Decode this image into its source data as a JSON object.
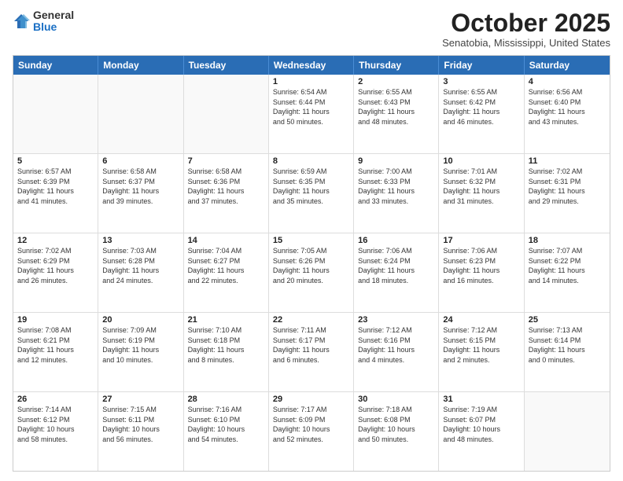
{
  "header": {
    "logo_general": "General",
    "logo_blue": "Blue",
    "month_title": "October 2025",
    "location": "Senatobia, Mississippi, United States"
  },
  "weekdays": [
    "Sunday",
    "Monday",
    "Tuesday",
    "Wednesday",
    "Thursday",
    "Friday",
    "Saturday"
  ],
  "rows": [
    [
      {
        "day": "",
        "info": ""
      },
      {
        "day": "",
        "info": ""
      },
      {
        "day": "",
        "info": ""
      },
      {
        "day": "1",
        "info": "Sunrise: 6:54 AM\nSunset: 6:44 PM\nDaylight: 11 hours\nand 50 minutes."
      },
      {
        "day": "2",
        "info": "Sunrise: 6:55 AM\nSunset: 6:43 PM\nDaylight: 11 hours\nand 48 minutes."
      },
      {
        "day": "3",
        "info": "Sunrise: 6:55 AM\nSunset: 6:42 PM\nDaylight: 11 hours\nand 46 minutes."
      },
      {
        "day": "4",
        "info": "Sunrise: 6:56 AM\nSunset: 6:40 PM\nDaylight: 11 hours\nand 43 minutes."
      }
    ],
    [
      {
        "day": "5",
        "info": "Sunrise: 6:57 AM\nSunset: 6:39 PM\nDaylight: 11 hours\nand 41 minutes."
      },
      {
        "day": "6",
        "info": "Sunrise: 6:58 AM\nSunset: 6:37 PM\nDaylight: 11 hours\nand 39 minutes."
      },
      {
        "day": "7",
        "info": "Sunrise: 6:58 AM\nSunset: 6:36 PM\nDaylight: 11 hours\nand 37 minutes."
      },
      {
        "day": "8",
        "info": "Sunrise: 6:59 AM\nSunset: 6:35 PM\nDaylight: 11 hours\nand 35 minutes."
      },
      {
        "day": "9",
        "info": "Sunrise: 7:00 AM\nSunset: 6:33 PM\nDaylight: 11 hours\nand 33 minutes."
      },
      {
        "day": "10",
        "info": "Sunrise: 7:01 AM\nSunset: 6:32 PM\nDaylight: 11 hours\nand 31 minutes."
      },
      {
        "day": "11",
        "info": "Sunrise: 7:02 AM\nSunset: 6:31 PM\nDaylight: 11 hours\nand 29 minutes."
      }
    ],
    [
      {
        "day": "12",
        "info": "Sunrise: 7:02 AM\nSunset: 6:29 PM\nDaylight: 11 hours\nand 26 minutes."
      },
      {
        "day": "13",
        "info": "Sunrise: 7:03 AM\nSunset: 6:28 PM\nDaylight: 11 hours\nand 24 minutes."
      },
      {
        "day": "14",
        "info": "Sunrise: 7:04 AM\nSunset: 6:27 PM\nDaylight: 11 hours\nand 22 minutes."
      },
      {
        "day": "15",
        "info": "Sunrise: 7:05 AM\nSunset: 6:26 PM\nDaylight: 11 hours\nand 20 minutes."
      },
      {
        "day": "16",
        "info": "Sunrise: 7:06 AM\nSunset: 6:24 PM\nDaylight: 11 hours\nand 18 minutes."
      },
      {
        "day": "17",
        "info": "Sunrise: 7:06 AM\nSunset: 6:23 PM\nDaylight: 11 hours\nand 16 minutes."
      },
      {
        "day": "18",
        "info": "Sunrise: 7:07 AM\nSunset: 6:22 PM\nDaylight: 11 hours\nand 14 minutes."
      }
    ],
    [
      {
        "day": "19",
        "info": "Sunrise: 7:08 AM\nSunset: 6:21 PM\nDaylight: 11 hours\nand 12 minutes."
      },
      {
        "day": "20",
        "info": "Sunrise: 7:09 AM\nSunset: 6:19 PM\nDaylight: 11 hours\nand 10 minutes."
      },
      {
        "day": "21",
        "info": "Sunrise: 7:10 AM\nSunset: 6:18 PM\nDaylight: 11 hours\nand 8 minutes."
      },
      {
        "day": "22",
        "info": "Sunrise: 7:11 AM\nSunset: 6:17 PM\nDaylight: 11 hours\nand 6 minutes."
      },
      {
        "day": "23",
        "info": "Sunrise: 7:12 AM\nSunset: 6:16 PM\nDaylight: 11 hours\nand 4 minutes."
      },
      {
        "day": "24",
        "info": "Sunrise: 7:12 AM\nSunset: 6:15 PM\nDaylight: 11 hours\nand 2 minutes."
      },
      {
        "day": "25",
        "info": "Sunrise: 7:13 AM\nSunset: 6:14 PM\nDaylight: 11 hours\nand 0 minutes."
      }
    ],
    [
      {
        "day": "26",
        "info": "Sunrise: 7:14 AM\nSunset: 6:12 PM\nDaylight: 10 hours\nand 58 minutes."
      },
      {
        "day": "27",
        "info": "Sunrise: 7:15 AM\nSunset: 6:11 PM\nDaylight: 10 hours\nand 56 minutes."
      },
      {
        "day": "28",
        "info": "Sunrise: 7:16 AM\nSunset: 6:10 PM\nDaylight: 10 hours\nand 54 minutes."
      },
      {
        "day": "29",
        "info": "Sunrise: 7:17 AM\nSunset: 6:09 PM\nDaylight: 10 hours\nand 52 minutes."
      },
      {
        "day": "30",
        "info": "Sunrise: 7:18 AM\nSunset: 6:08 PM\nDaylight: 10 hours\nand 50 minutes."
      },
      {
        "day": "31",
        "info": "Sunrise: 7:19 AM\nSunset: 6:07 PM\nDaylight: 10 hours\nand 48 minutes."
      },
      {
        "day": "",
        "info": ""
      }
    ]
  ]
}
